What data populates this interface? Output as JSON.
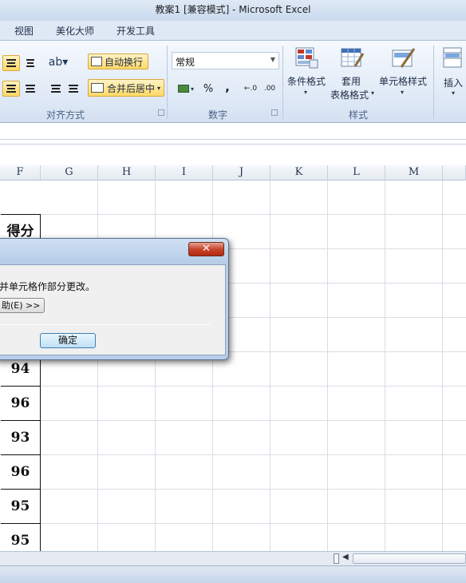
{
  "window": {
    "title": "教案1  [兼容模式]  -  Microsoft Excel"
  },
  "tabs": [
    {
      "label": "视图"
    },
    {
      "label": "美化大师"
    },
    {
      "label": "开发工具"
    }
  ],
  "ribbon": {
    "alignment": {
      "wrap_text": "自动换行",
      "merge_center": "合并后居中",
      "group_label": "对齐方式"
    },
    "number": {
      "format_value": "常规",
      "percent": "%",
      "comma": ",",
      "group_label": "数字"
    },
    "styles": {
      "conditional_formatting": "条件格式",
      "format_as_table_line1": "套用",
      "format_as_table_line2": "表格格式",
      "cell_styles": "单元格样式",
      "group_label": "样式"
    },
    "cells": {
      "insert": "插入"
    }
  },
  "grid": {
    "columns": [
      "F",
      "G",
      "H",
      "I",
      "J",
      "K",
      "L",
      "M"
    ],
    "header_cell": "得分",
    "scores": [
      "94",
      "96",
      "93",
      "96",
      "95",
      "95"
    ]
  },
  "dialog": {
    "close": "✕",
    "message": "并单元格作部分更改。",
    "help_button": "助(E) >>",
    "ok_button": "确定"
  },
  "colors": {
    "ribbon_bg": "#dce7f5",
    "highlight": "#ffd966",
    "close_red": "#c8442c"
  }
}
